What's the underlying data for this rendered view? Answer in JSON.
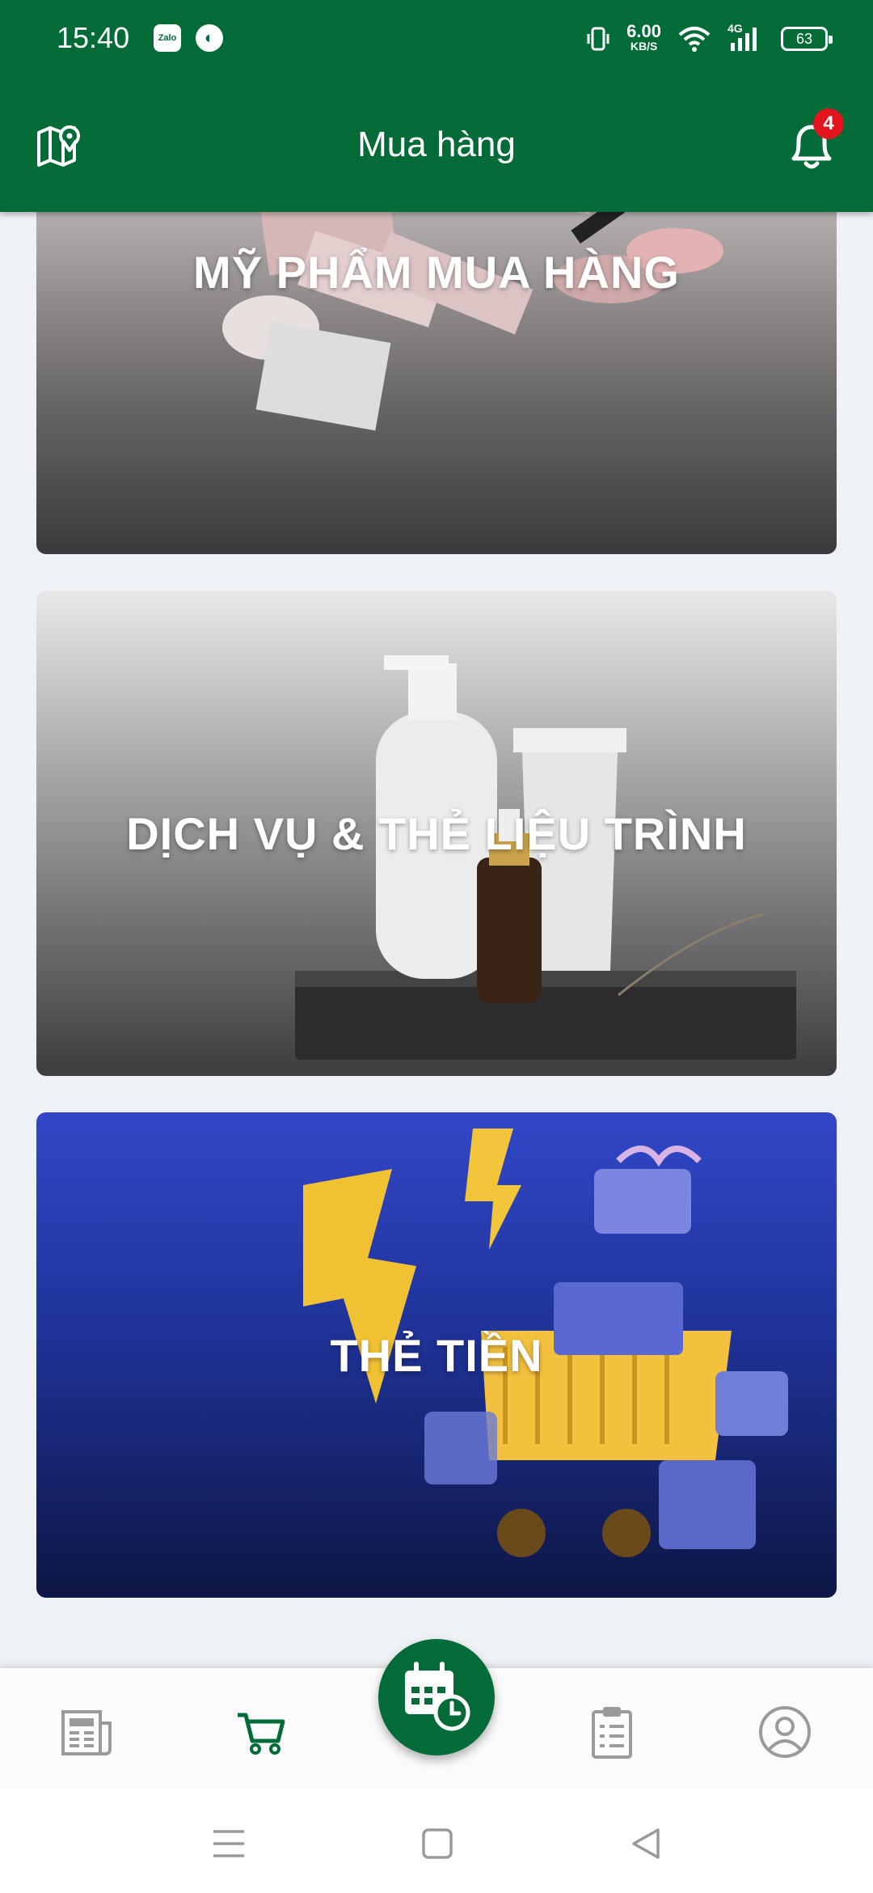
{
  "status_bar": {
    "time": "15:40",
    "app_icons": [
      "Zalo",
      "◐"
    ],
    "network_speed_value": "6.00",
    "network_speed_unit": "KB/S",
    "network_type": "4G",
    "battery": "63"
  },
  "header": {
    "title": "Mua hàng",
    "notification_count": "4",
    "icons": [
      "map-pin-icon",
      "bell-icon"
    ]
  },
  "cards": [
    {
      "label": "MỸ PHẨM MUA HÀNG"
    },
    {
      "label": "DỊCH VỤ & THẺ LIỆU TRÌNH"
    },
    {
      "label": "THẺ TIỀN"
    }
  ],
  "bottom_nav": {
    "items": [
      "newspaper-icon",
      "cart-icon",
      "calendar-clock-icon",
      "clipboard-icon",
      "user-icon"
    ],
    "active": "cart-icon",
    "colors": {
      "active": "#036b37",
      "inactive": "#9a9a9a"
    }
  },
  "theme": {
    "primary": "#036b37",
    "badge": "#e2141e"
  }
}
